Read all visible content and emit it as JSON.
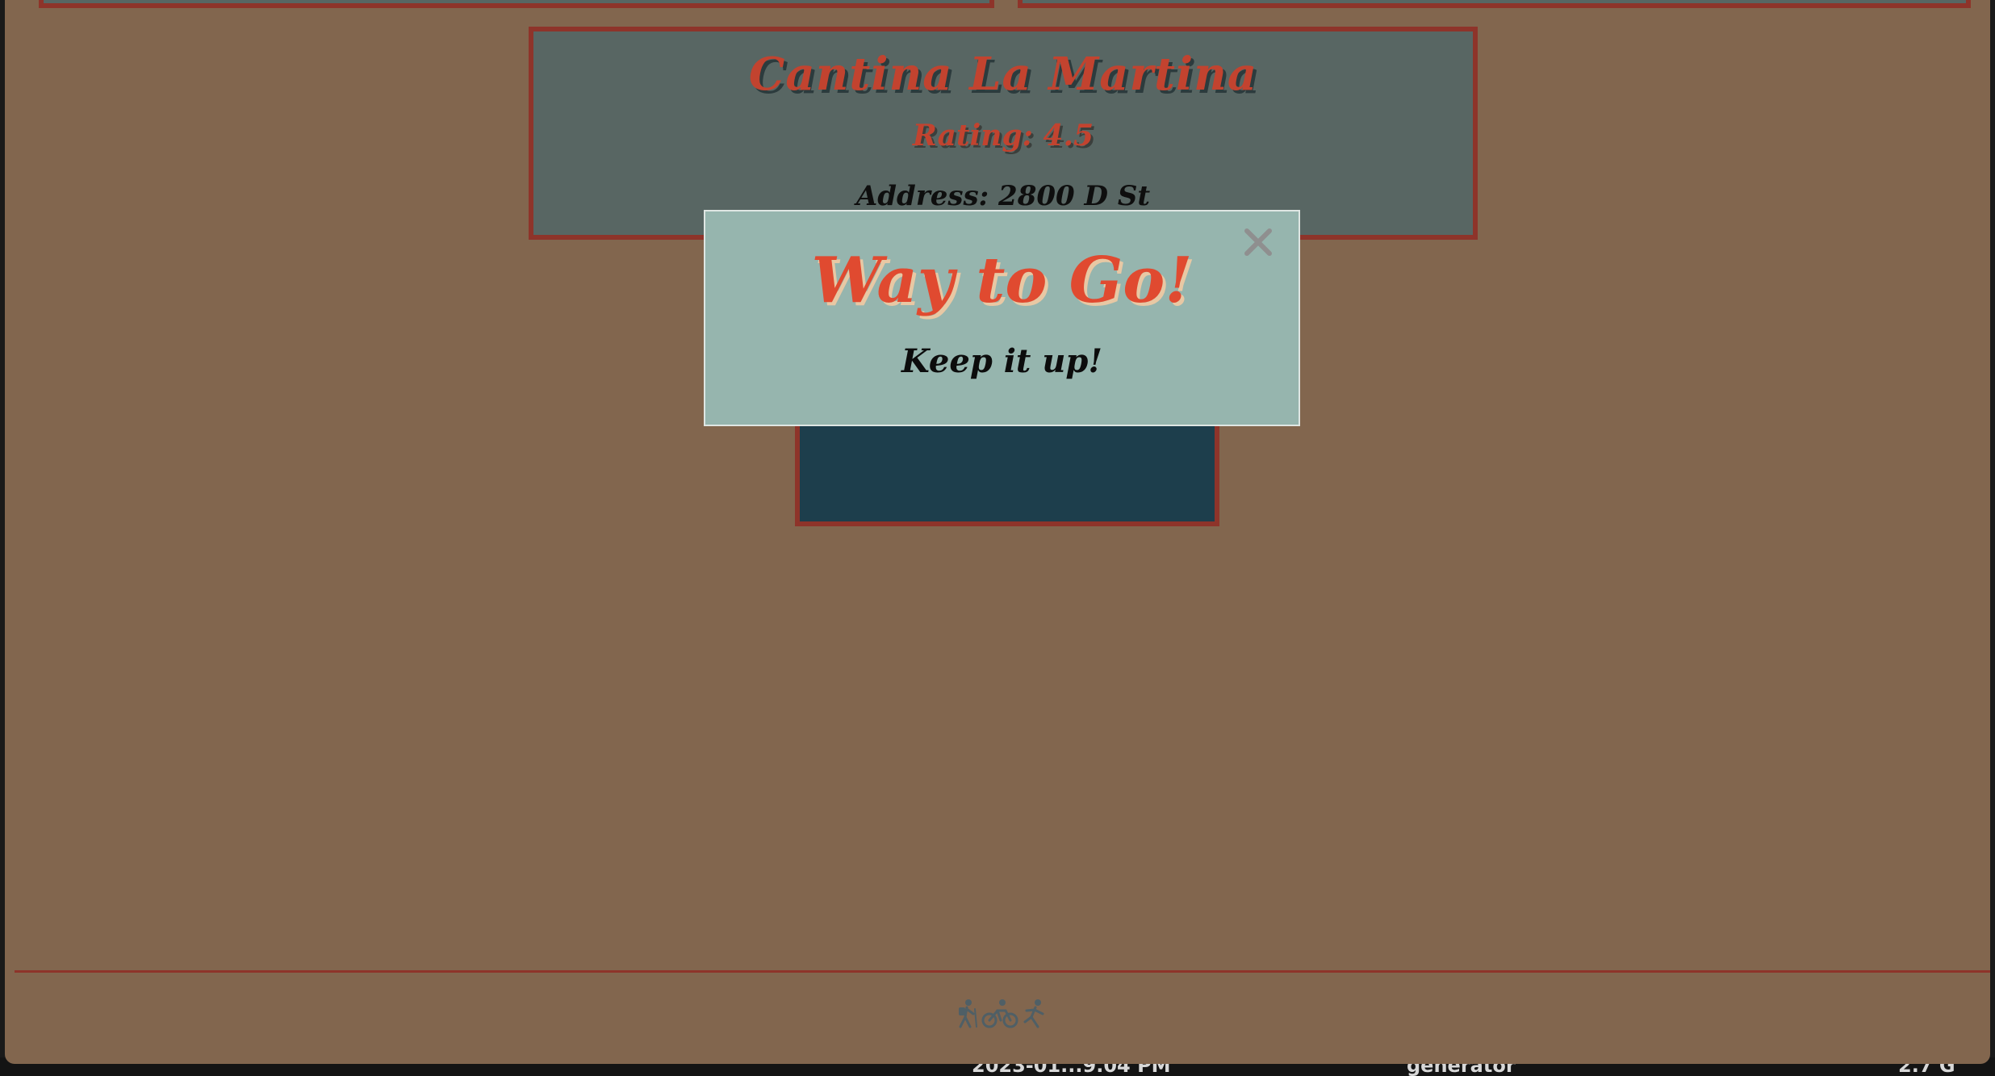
{
  "page": {
    "background_color": "#82664e",
    "accent_color": "#8e342a"
  },
  "restaurant_card": {
    "name": "Cantina La Martina",
    "rating": "Rating: 4.5",
    "address": "Address: 2800 D St"
  },
  "modal": {
    "title": "Way to Go!",
    "message": "Keep it up!",
    "close_icon": "close-icon"
  },
  "footer": {
    "icons": [
      "hiking-icon",
      "bicycle-icon",
      "running-icon"
    ]
  },
  "desktop_strip": {
    "item_1": "2023-01...9.04 PM",
    "item_2": "generator",
    "item_3": "2.7 G"
  }
}
